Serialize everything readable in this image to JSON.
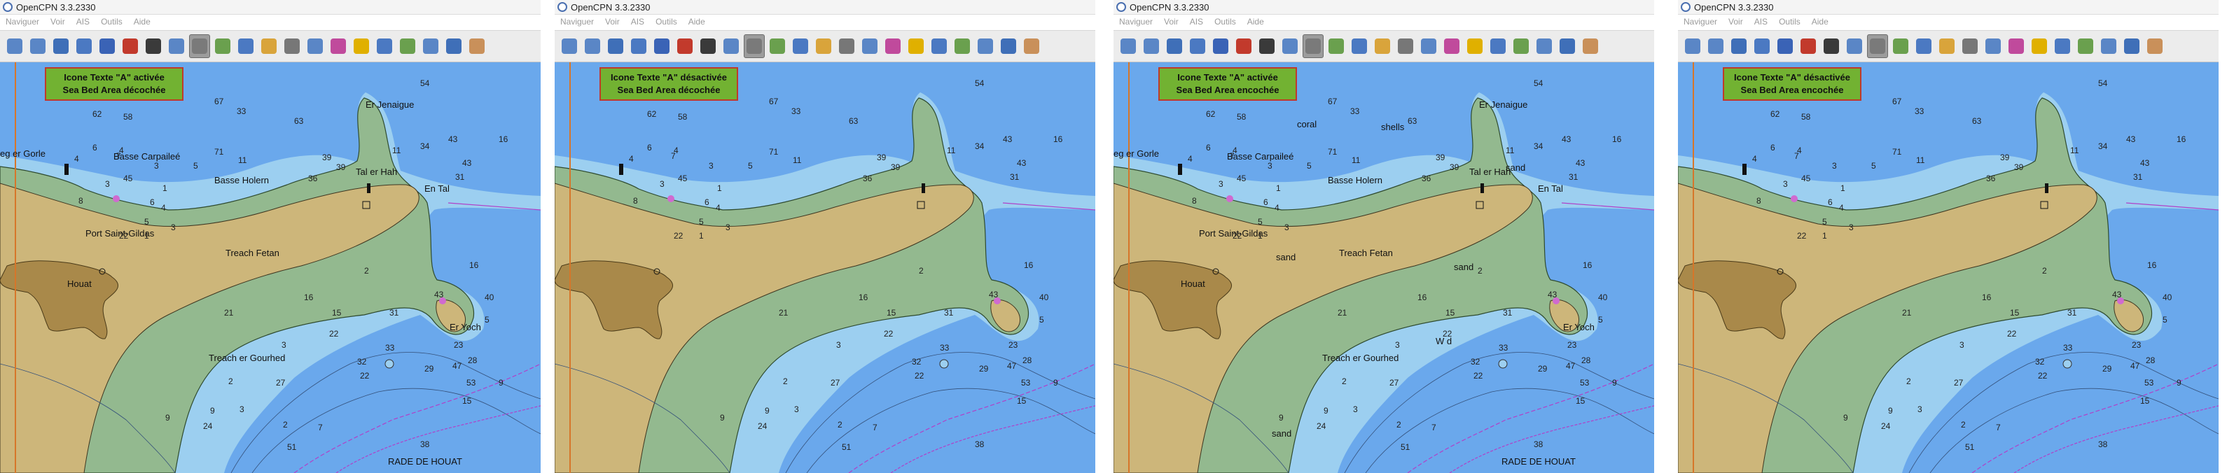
{
  "window_title": "OpenCPN 3.3.2330",
  "menu": [
    "Naviguer",
    "Voir",
    "AIS",
    "Outils",
    "Aide"
  ],
  "tool_icons": [
    "zoom-in-icon",
    "zoom-out-icon",
    "scale-icon",
    "chart-quilt-icon",
    "route-icon",
    "ship-icon",
    "stop-icon",
    "track-icon",
    "text-toggle-icon",
    "settings-icon",
    "tide-icon",
    "current-icon",
    "print-icon",
    "chart-icon",
    "mark-icon",
    "gps-icon",
    "help-icon",
    "ais-icon",
    "color-icon",
    "layers-icon",
    "info-icon"
  ],
  "panels": [
    {
      "note_line1": "Icone Texte \"A\" activée",
      "note_line2": "Sea Bed Area décochée",
      "labels": [
        "Er Jenaigue",
        "Basse Carpaileé",
        "Basse Holern",
        "Tal er Hah",
        "En Tal",
        "Port Saint-Gildas",
        "Treach Fetan",
        "Houat",
        "Er Yoch",
        "Treach er Gourhed",
        "RADE DE HOUAT",
        "eg er Gorle"
      ],
      "depths": [
        "23",
        "33",
        "62",
        "67",
        "58",
        "71",
        "6",
        "4",
        "4",
        "54",
        "63",
        "7",
        "3",
        "5",
        "11",
        "3",
        "11",
        "34",
        "43",
        "39",
        "16",
        "36",
        "39",
        "45",
        "1",
        "6",
        "8",
        "5",
        "43",
        "31",
        "4",
        "3",
        "1",
        "22",
        "16",
        "2",
        "15",
        "31",
        "43",
        "40",
        "5",
        "21",
        "16",
        "22",
        "23",
        "3",
        "33",
        "32",
        "47",
        "53",
        "22",
        "9",
        "27",
        "2",
        "3",
        "9",
        "9",
        "24",
        "2",
        "7",
        "15",
        "29",
        "28",
        "38",
        "51"
      ]
    },
    {
      "note_line1": "Icone Texte \"A\" désactivée",
      "note_line2": "Sea Bed Area décochée",
      "labels": [],
      "depths": [
        "23",
        "33",
        "62",
        "67",
        "58",
        "71",
        "6",
        "4",
        "4",
        "54",
        "63",
        "7",
        "3",
        "5",
        "11",
        "3",
        "11",
        "34",
        "43",
        "39",
        "16",
        "36",
        "39",
        "45",
        "1",
        "6",
        "8",
        "5",
        "43",
        "31",
        "4",
        "3",
        "1",
        "22",
        "16",
        "2",
        "15",
        "31",
        "43",
        "40",
        "5",
        "21",
        "16",
        "22",
        "23",
        "3",
        "33",
        "32",
        "47",
        "53",
        "22",
        "9",
        "27",
        "2",
        "3",
        "9",
        "9",
        "24",
        "2",
        "7",
        "15",
        "29",
        "28",
        "38",
        "51"
      ]
    },
    {
      "note_line1": "Icone Texte \"A\" activée",
      "note_line2": "Sea Bed Area encochée",
      "labels": [
        "Er Jenaigue",
        "Basse Carpaileé",
        "Basse Holern",
        "Tal er Hah",
        "En Tal",
        "Port Saint-Gildas",
        "Treach Fetan",
        "Houat",
        "Er Yoch",
        "Treach er Gourhed",
        "RADE DE HOUAT",
        "eg er Gorle",
        "coral",
        "shells",
        "sand",
        "sand",
        "sand",
        "sand",
        "W d"
      ],
      "depths": [
        "23",
        "33",
        "62",
        "67",
        "58",
        "71",
        "6",
        "4",
        "4",
        "54",
        "63",
        "7",
        "3",
        "5",
        "11",
        "3",
        "11",
        "34",
        "43",
        "39",
        "16",
        "36",
        "39",
        "45",
        "1",
        "6",
        "8",
        "5",
        "43",
        "31",
        "4",
        "3",
        "1",
        "22",
        "16",
        "2",
        "15",
        "31",
        "43",
        "40",
        "5",
        "21",
        "16",
        "22",
        "23",
        "3",
        "33",
        "32",
        "47",
        "53",
        "22",
        "9",
        "27",
        "2",
        "3",
        "9",
        "9",
        "24",
        "2",
        "7",
        "15",
        "29",
        "28",
        "38",
        "51"
      ]
    },
    {
      "note_line1": "Icone Texte \"A\" désactivée",
      "note_line2": "Sea Bed Area encochée",
      "labels": [],
      "depths": [
        "23",
        "33",
        "62",
        "67",
        "58",
        "71",
        "6",
        "4",
        "4",
        "54",
        "63",
        "7",
        "3",
        "5",
        "11",
        "3",
        "11",
        "34",
        "43",
        "39",
        "16",
        "36",
        "39",
        "45",
        "1",
        "6",
        "8",
        "5",
        "43",
        "31",
        "4",
        "3",
        "1",
        "22",
        "16",
        "2",
        "15",
        "31",
        "43",
        "40",
        "5",
        "21",
        "16",
        "22",
        "23",
        "3",
        "33",
        "32",
        "47",
        "53",
        "22",
        "9",
        "27",
        "2",
        "3",
        "9",
        "9",
        "24",
        "2",
        "7",
        "15",
        "29",
        "28",
        "38",
        "51"
      ]
    }
  ],
  "colors": {
    "deep_water": "#6aa8ec",
    "shallow_water": "#9ccff0",
    "intertidal": "#93b98f",
    "land": "#cdb67a",
    "built_area": "#a9894a",
    "note_bg": "#72b232",
    "note_border": "#c0392b",
    "route_line": "#b040c8"
  }
}
